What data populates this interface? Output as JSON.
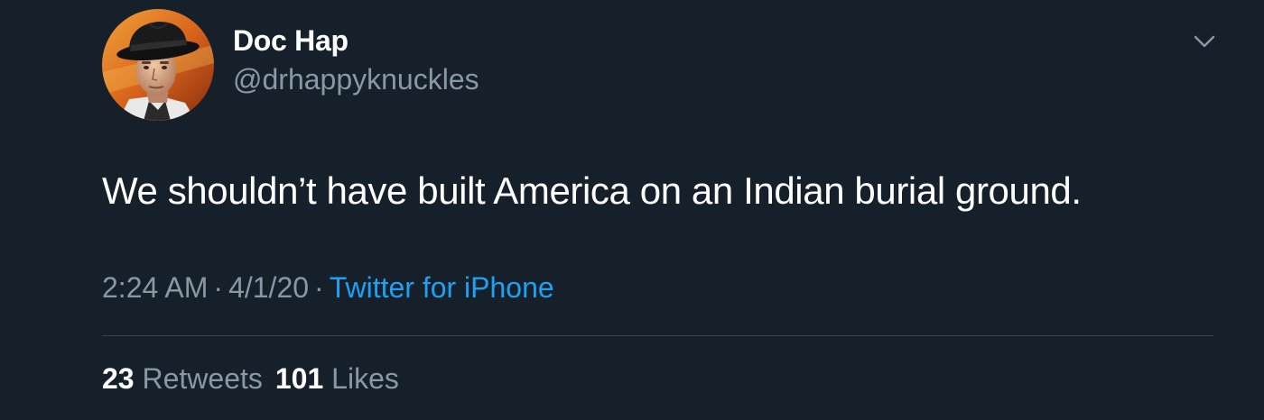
{
  "author": {
    "display_name": "Doc Hap",
    "handle": "@drhappyknuckles"
  },
  "tweet": {
    "text": "We shouldn’t have built America on an Indian burial ground.",
    "time": "2:24 AM",
    "date": "4/1/20",
    "separator": "·",
    "source": "Twitter for iPhone"
  },
  "stats": {
    "retweets_count": "23",
    "retweets_label": "Retweets",
    "likes_count": "101",
    "likes_label": "Likes"
  },
  "icons": {
    "menu": "chevron-down-icon"
  },
  "colors": {
    "background": "#16202b",
    "primary_text": "#ffffff",
    "secondary_text": "#8899a6",
    "link": "#1da1f2",
    "divider": "#38444d"
  }
}
